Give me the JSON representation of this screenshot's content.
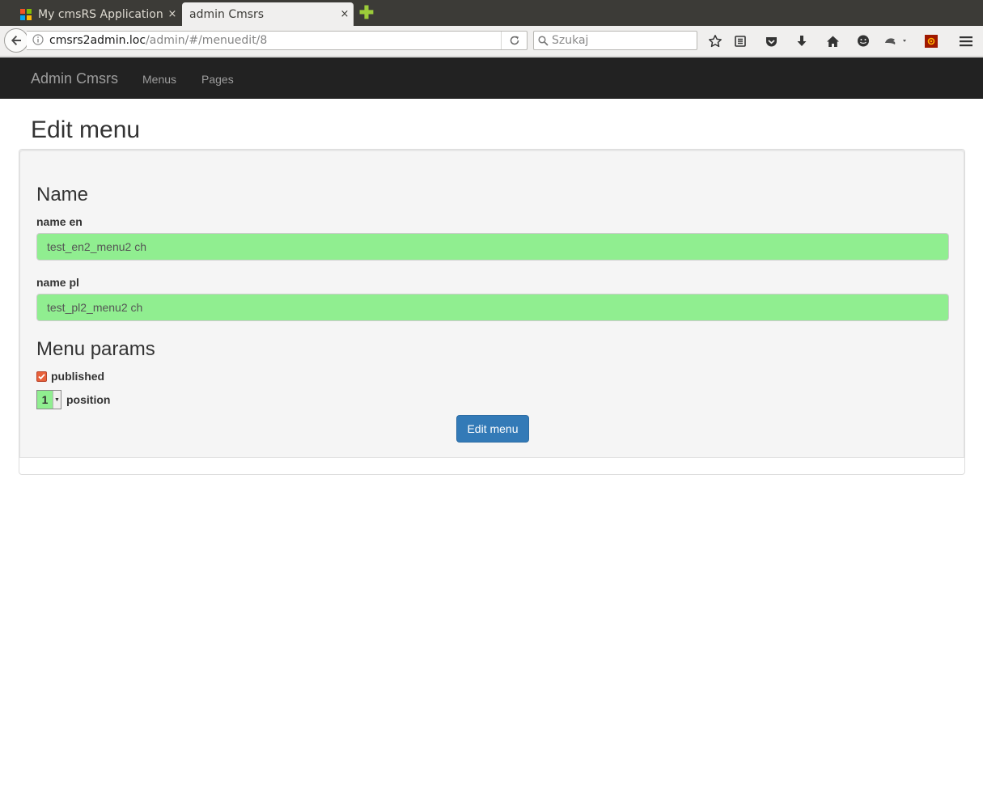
{
  "browser": {
    "tabs": [
      {
        "title": "My cmsRS Application",
        "close": "×"
      },
      {
        "title": "admin Cmsrs",
        "close": "×"
      }
    ],
    "new_tab": "✚",
    "url": {
      "host": "cmsrs2admin.loc",
      "path": "/admin/#/menuedit/8"
    },
    "search_placeholder": "Szukaj"
  },
  "app_navbar": {
    "brand": "Admin Cmsrs",
    "links": [
      "Menus",
      "Pages"
    ]
  },
  "page": {
    "title": "Edit menu"
  },
  "form": {
    "name_section": "Name",
    "name_en_label": "name en",
    "name_en_value": "test_en2_menu2 ch",
    "name_pl_label": "name pl",
    "name_pl_value": "test_pl2_menu2 ch",
    "params_section": "Menu params",
    "published_label": "published",
    "published": true,
    "position_value": "1",
    "position_label": "position",
    "submit_label": "Edit menu"
  },
  "colors": {
    "input_bg": "#90ee90",
    "primary": "#337ab7",
    "navbar_bg": "#222222"
  }
}
